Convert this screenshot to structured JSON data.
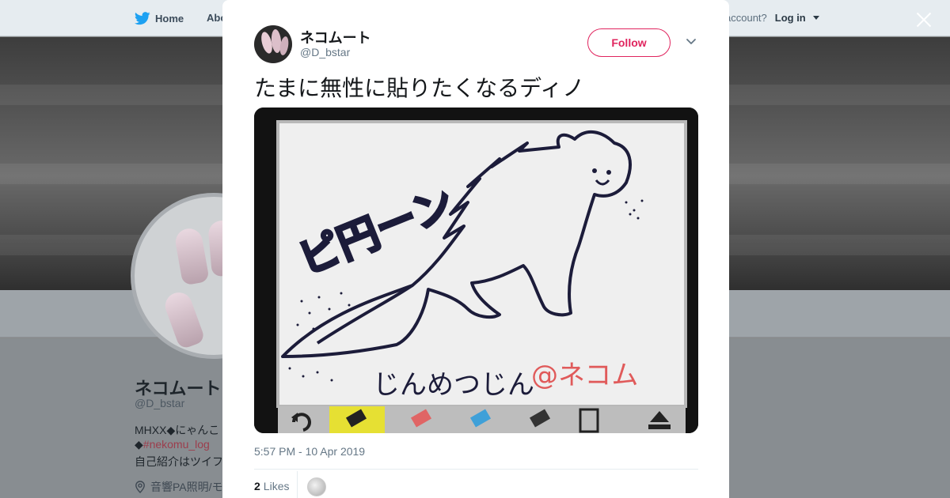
{
  "nav": {
    "home": "Home",
    "about": "Abo",
    "account_prompt": "account?",
    "login": "Log in"
  },
  "profile": {
    "name": "ネコムート",
    "handle": "@D_bstar",
    "bio_line1": "MHXX◆にゃんこ",
    "bio_line2_prefix": "◆",
    "bio_line2_tag": "#nekomu_log",
    "bio_line3": "自己紹介はツイフ",
    "location": "音響PA照明/モ"
  },
  "tweet": {
    "user_name": "ネコムート",
    "user_handle": "@D_bstar",
    "follow_label": "Follow",
    "text": "たまに無性に貼りたくなるディノ",
    "image_text_1": "ピ円ーン",
    "image_text_2": "じんめつじん",
    "image_text_3": "@ネコム",
    "timestamp": "5:57 PM - 10 Apr 2019",
    "likes_count": "2",
    "likes_label": "Likes"
  },
  "colors": {
    "follow": "#e0245e",
    "link_tag": "#9c3d4c",
    "twitter_blue": "#1da1f2"
  },
  "icons": {
    "home": "twitter-bird-icon",
    "close": "close-icon",
    "menu": "chevron-down-icon",
    "location": "location-pin-icon"
  }
}
